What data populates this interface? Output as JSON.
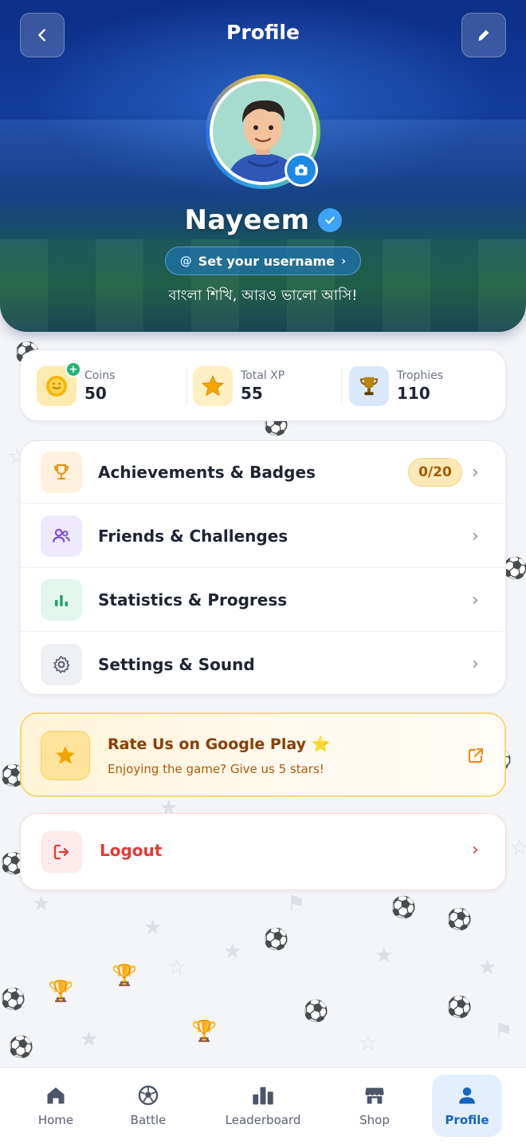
{
  "header": {
    "title": "Profile",
    "back_icon": "chevron-left-icon",
    "edit_icon": "pencil-icon"
  },
  "profile": {
    "name": "Nayeem",
    "username_prompt": "Set your username",
    "username_prefix": "@",
    "username_chevron": "›",
    "tagline": "বাংলা শিখি, আরও ভালো আসি!"
  },
  "stats": [
    {
      "label": "Coins",
      "value": "50",
      "icon": "coin-icon",
      "color": "#fdeab0"
    },
    {
      "label": "Total XP",
      "value": "55",
      "icon": "star-icon",
      "color": "#fff0c4"
    },
    {
      "label": "Trophies",
      "value": "110",
      "icon": "trophy-icon",
      "color": "#dbe8fb"
    }
  ],
  "menu": [
    {
      "label": "Achievements & Badges",
      "badge": "0/20",
      "icon": "trophy-icon",
      "icon_bg": "#fff1dc",
      "icon_color": "#e8910f"
    },
    {
      "label": "Friends & Challenges",
      "icon": "users-icon",
      "icon_bg": "#efe9fd",
      "icon_color": "#7c4dd6"
    },
    {
      "label": "Statistics & Progress",
      "icon": "bar-chart-icon",
      "icon_bg": "#e3f6ee",
      "icon_color": "#1fa56b"
    },
    {
      "label": "Settings & Sound",
      "icon": "gear-icon",
      "icon_bg": "#eef0f3",
      "icon_color": "#5b6275"
    }
  ],
  "rate": {
    "title": "Rate Us on Google Play ⭐",
    "subtitle": "Enjoying the game? Give us 5 stars!"
  },
  "logout": {
    "label": "Logout"
  },
  "nav": [
    {
      "label": "Home",
      "icon": "home-icon"
    },
    {
      "label": "Battle",
      "icon": "soccer-ball-icon"
    },
    {
      "label": "Leaderboard",
      "icon": "podium-icon"
    },
    {
      "label": "Shop",
      "icon": "store-icon"
    },
    {
      "label": "Profile",
      "icon": "user-icon",
      "active": true
    }
  ],
  "colors": {
    "primary": "#1565c0",
    "accent_gold": "#f5b800",
    "danger": "#e53935"
  }
}
